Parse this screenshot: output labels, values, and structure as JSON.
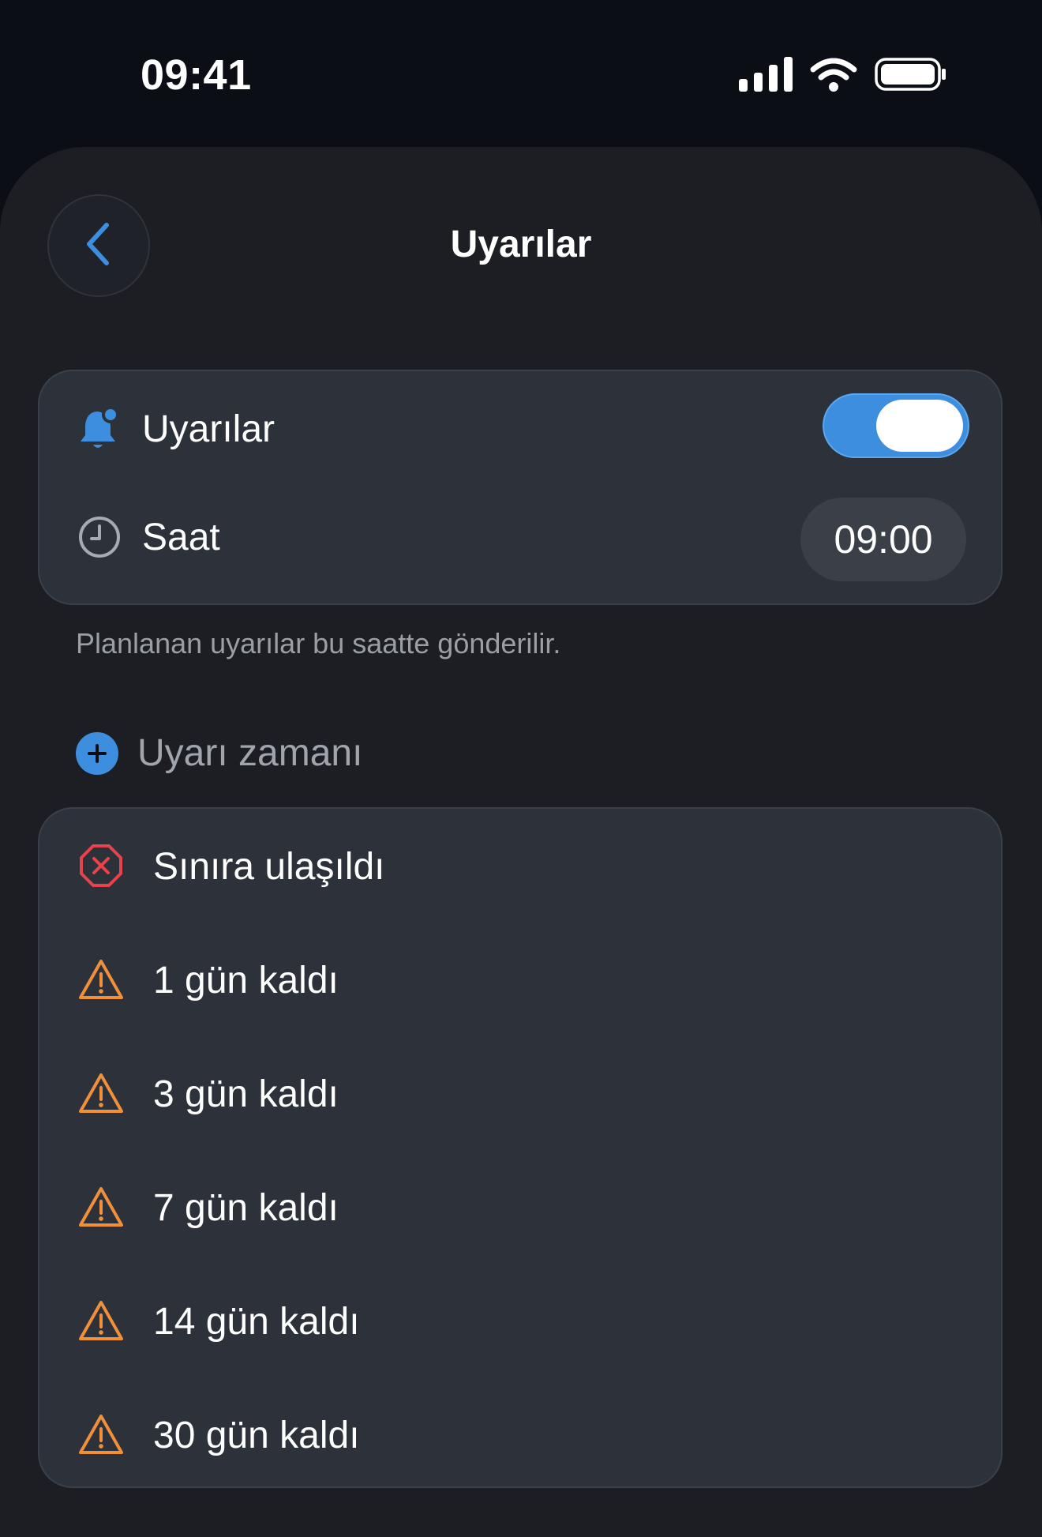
{
  "status_bar": {
    "time": "09:41",
    "icons": [
      "signal-icon",
      "wifi-icon",
      "battery-icon"
    ]
  },
  "header": {
    "back_icon": "chevron-left-icon",
    "title": "Uyarılar"
  },
  "settings": {
    "alerts_label": "Uyarılar",
    "alerts_icon": "bell-badge-icon",
    "alerts_enabled": true,
    "time_label": "Saat",
    "time_icon": "clock-icon",
    "time_value": "09:00"
  },
  "helper_text": "Planlanan uyarılar bu saatte gönderilir.",
  "add_alert": {
    "icon": "plus-circle-icon",
    "label": "Uyarı zamanı"
  },
  "alert_items": [
    {
      "label": "Sınıra ulaşıldı",
      "icon": "x-octagon-icon"
    },
    {
      "label": "1 gün kaldı",
      "icon": "warning-triangle-icon"
    },
    {
      "label": "3 gün kaldı",
      "icon": "warning-triangle-icon"
    },
    {
      "label": "7 gün kaldı",
      "icon": "warning-triangle-icon"
    },
    {
      "label": "14 gün kaldı",
      "icon": "warning-triangle-icon"
    },
    {
      "label": "30 gün kaldı",
      "icon": "warning-triangle-icon"
    }
  ],
  "colors": {
    "accent": "#3d8ede",
    "danger": "#e8434b",
    "warning": "#f0903a",
    "background": "#1c1e23",
    "card": "#2c313a"
  }
}
